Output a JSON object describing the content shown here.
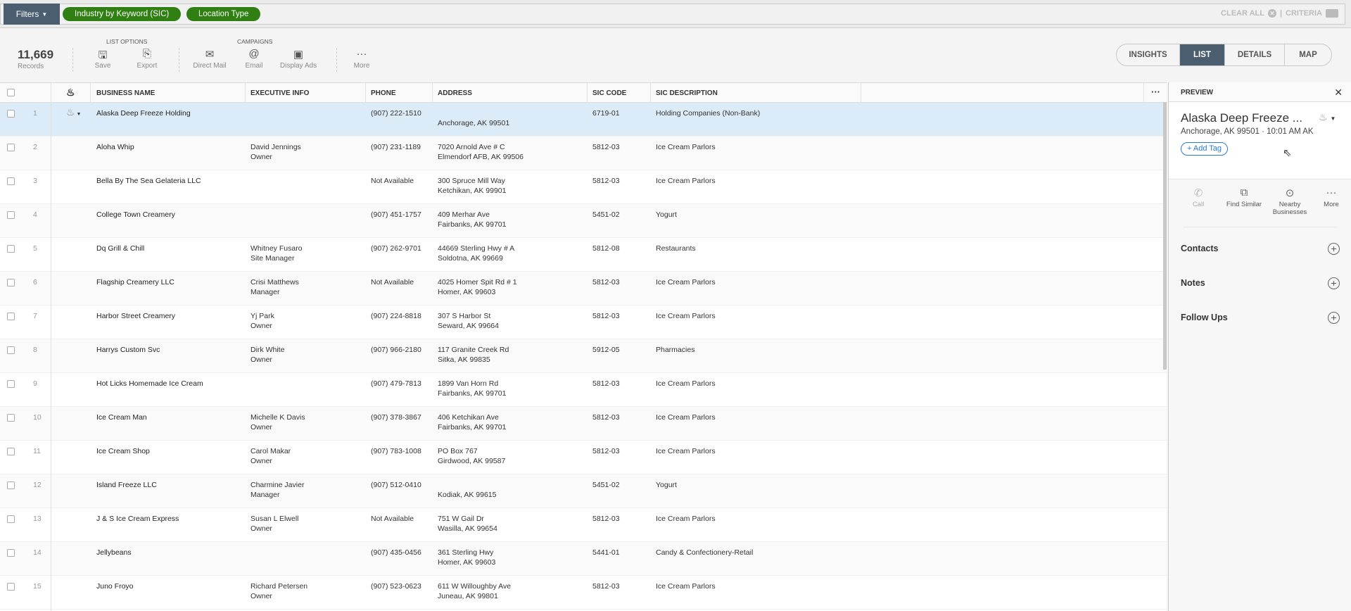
{
  "filters": {
    "button": "Filters",
    "chips": [
      "Industry by Keyword (SIC)",
      "Location Type"
    ],
    "clear_all": "CLEAR ALL",
    "criteria": "CRITERIA"
  },
  "toolbar": {
    "records_count": "11,669",
    "records_label": "Records",
    "list_options": "LIST OPTIONS",
    "campaigns": "CAMPAIGNS",
    "save": "Save",
    "export": "Export",
    "direct_mail": "Direct Mail",
    "email": "Email",
    "display_ads": "Display Ads",
    "more": "More"
  },
  "views": {
    "tabs": [
      "INSIGHTS",
      "LIST",
      "DETAILS",
      "MAP"
    ],
    "active": "LIST"
  },
  "table": {
    "columns": [
      "BUSINESS NAME",
      "EXECUTIVE INFO",
      "PHONE",
      "ADDRESS",
      "SIC CODE",
      "SIC DESCRIPTION"
    ],
    "rows": [
      {
        "n": "1",
        "name": "Alaska Deep Freeze Holding",
        "exec1": "",
        "exec2": "",
        "phone": "(907) 222-1510",
        "addr1": "",
        "addr2": "Anchorage, AK 99501",
        "sic": "6719-01",
        "desc": "Holding Companies (Non-Bank)"
      },
      {
        "n": "2",
        "name": "Aloha Whip",
        "exec1": "David Jennings",
        "exec2": "Owner",
        "phone": "(907) 231-1189",
        "addr1": "7020 Arnold Ave # C",
        "addr2": "Elmendorf AFB, AK 99506",
        "sic": "5812-03",
        "desc": "Ice Cream Parlors"
      },
      {
        "n": "3",
        "name": "Bella By The Sea Gelateria LLC",
        "exec1": "",
        "exec2": "",
        "phone": "Not Available",
        "addr1": "300 Spruce Mill Way",
        "addr2": "Ketchikan, AK 99901",
        "sic": "5812-03",
        "desc": "Ice Cream Parlors"
      },
      {
        "n": "4",
        "name": "College Town Creamery",
        "exec1": "",
        "exec2": "",
        "phone": "(907) 451-1757",
        "addr1": "409 Merhar Ave",
        "addr2": "Fairbanks, AK 99701",
        "sic": "5451-02",
        "desc": "Yogurt"
      },
      {
        "n": "5",
        "name": "Dq Grill & Chill",
        "exec1": "Whitney Fusaro",
        "exec2": "Site Manager",
        "phone": "(907) 262-9701",
        "addr1": "44669 Sterling Hwy # A",
        "addr2": "Soldotna, AK 99669",
        "sic": "5812-08",
        "desc": "Restaurants"
      },
      {
        "n": "6",
        "name": "Flagship Creamery LLC",
        "exec1": "Crisi Matthews",
        "exec2": "Manager",
        "phone": "Not Available",
        "addr1": "4025 Homer Spit Rd # 1",
        "addr2": "Homer, AK 99603",
        "sic": "5812-03",
        "desc": "Ice Cream Parlors"
      },
      {
        "n": "7",
        "name": "Harbor Street Creamery",
        "exec1": "Yj Park",
        "exec2": "Owner",
        "phone": "(907) 224-8818",
        "addr1": "307 S Harbor St",
        "addr2": "Seward, AK 99664",
        "sic": "5812-03",
        "desc": "Ice Cream Parlors"
      },
      {
        "n": "8",
        "name": "Harrys Custom Svc",
        "exec1": "Dirk White",
        "exec2": "Owner",
        "phone": "(907) 966-2180",
        "addr1": "117 Granite Creek Rd",
        "addr2": "Sitka, AK 99835",
        "sic": "5912-05",
        "desc": "Pharmacies"
      },
      {
        "n": "9",
        "name": "Hot Licks Homemade Ice Cream",
        "exec1": "",
        "exec2": "",
        "phone": "(907) 479-7813",
        "addr1": "1899 Van Horn Rd",
        "addr2": "Fairbanks, AK 99701",
        "sic": "5812-03",
        "desc": "Ice Cream Parlors"
      },
      {
        "n": "10",
        "name": "Ice Cream Man",
        "exec1": "Michelle K Davis",
        "exec2": "Owner",
        "phone": "(907) 378-3867",
        "addr1": "406 Ketchikan Ave",
        "addr2": "Fairbanks, AK 99701",
        "sic": "5812-03",
        "desc": "Ice Cream Parlors"
      },
      {
        "n": "11",
        "name": "Ice Cream Shop",
        "exec1": "Carol Makar",
        "exec2": "Owner",
        "phone": "(907) 783-1008",
        "addr1": "PO Box 767",
        "addr2": "Girdwood, AK 99587",
        "sic": "5812-03",
        "desc": "Ice Cream Parlors"
      },
      {
        "n": "12",
        "name": "Island Freeze LLC",
        "exec1": "Charmine Javier",
        "exec2": "Manager",
        "phone": "(907) 512-0410",
        "addr1": "",
        "addr2": "Kodiak, AK 99615",
        "sic": "5451-02",
        "desc": "Yogurt"
      },
      {
        "n": "13",
        "name": "J & S Ice Cream Express",
        "exec1": "Susan L Elwell",
        "exec2": "Owner",
        "phone": "Not Available",
        "addr1": "751 W Gail Dr",
        "addr2": "Wasilla, AK 99654",
        "sic": "5812-03",
        "desc": "Ice Cream Parlors"
      },
      {
        "n": "14",
        "name": "Jellybeans",
        "exec1": "",
        "exec2": "",
        "phone": "(907) 435-0456",
        "addr1": "361 Sterling Hwy",
        "addr2": "Homer, AK 99603",
        "sic": "5441-01",
        "desc": "Candy & Confectionery-Retail"
      },
      {
        "n": "15",
        "name": "Juno Froyo",
        "exec1": "Richard Petersen",
        "exec2": "Owner",
        "phone": "(907) 523-0623",
        "addr1": "611 W Willoughby Ave",
        "addr2": "Juneau, AK 99801",
        "sic": "5812-03",
        "desc": "Ice Cream Parlors"
      }
    ]
  },
  "preview": {
    "header": "PREVIEW",
    "title": "Alaska Deep Freeze ...",
    "subtitle": "Anchorage, AK 99501 · 10:01 AM AK",
    "add_tag": "Add Tag",
    "actions": {
      "call": "Call",
      "find_similar": "Find Similar",
      "nearby": "Nearby Businesses",
      "more": "More"
    },
    "sections": [
      "Contacts",
      "Notes",
      "Follow Ups"
    ]
  }
}
